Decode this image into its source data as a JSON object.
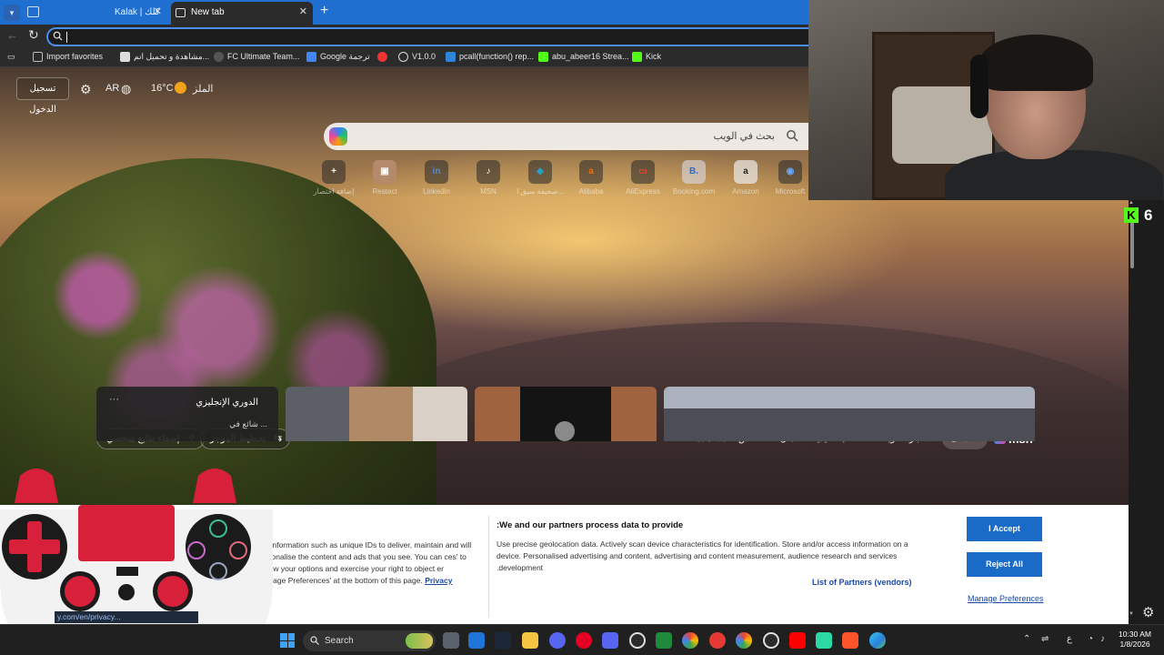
{
  "browser": {
    "tabs": [
      {
        "label": "Kalak | كلك"
      },
      {
        "label": "New tab"
      }
    ],
    "address_value": "",
    "bookmarks": [
      {
        "label": "Import favorites",
        "icon": "import-icon"
      },
      {
        "label": "مشاهدة و تحميل انم...",
        "icon": "page-icon"
      },
      {
        "label": "FC Ultimate Team...",
        "icon": "fc-icon"
      },
      {
        "label": "Google ترجمة",
        "icon": "translate-icon"
      },
      {
        "label": "",
        "icon": "youtube-icon"
      },
      {
        "label": "V1.0.0",
        "icon": "globe-icon"
      },
      {
        "label": "pcall(function() rep...",
        "icon": "bing-icon"
      },
      {
        "label": "abu_abeer16 Strea...",
        "icon": "kick-icon"
      },
      {
        "label": "Kick",
        "icon": "kick-icon"
      }
    ]
  },
  "newtab": {
    "login": "تسجيل الدخول",
    "lang": "AR",
    "temp": "16°C",
    "weather_loc": "الملز",
    "search_placeholder": "بحث في الويب",
    "quick_links": [
      {
        "label": "إضافة اختصار",
        "glyph": "+"
      },
      {
        "label": "Restect",
        "glyph": "▣"
      },
      {
        "label": "Linkedin",
        "glyph": "in"
      },
      {
        "label": "MSN",
        "glyph": "♪"
      },
      {
        "label": "صحيفة سبق ا...",
        "glyph": "◆"
      },
      {
        "label": "Alibaba",
        "glyph": "a"
      },
      {
        "label": "AliExpress",
        "glyph": "▭"
      },
      {
        "label": "Booking.com",
        "glyph": "B."
      },
      {
        "label": "Amazon",
        "glyph": "a"
      },
      {
        "label": "Microsoft",
        "glyph": "◉"
      }
    ],
    "feed": {
      "personalize": "إضفاء طابع شخصي",
      "layout": "تخطيط الموجز",
      "nav": [
        "مشاهدة",
        "الطقس",
        "المال",
        "ألعاب تقليدية",
        "رياضة",
        "الأخبار"
      ],
      "discover": "اكتشاف",
      "logo": "msn",
      "league_title": "الدوري الإنجليزي",
      "league_sub": "شائع في ..."
    }
  },
  "consent": {
    "left_text": "ess information such as unique IDs to deliver, maintain and will personalise the content and ads that you see. You can ces' to review your options and exercise your right to object er 'Manage Preferences' at the bottom of this page.",
    "privacy": "Privacy",
    "title": ":We and our partners process data to provide",
    "text": "Use precise geolocation data. Actively scan device characteristics for identification. Store and/or access information on a device. Personalised advertising and content, advertising and content measurement, audience research and services .development",
    "partners": "List of Partners (vendors)",
    "accept": "I Accept",
    "reject": "Reject All",
    "manage": "Manage Preferences",
    "url_fragment": "y.com/en/privacy..."
  },
  "stream": {
    "kick_viewers": "6"
  },
  "taskbar": {
    "search": "Search",
    "time": "10:30 AM",
    "date": "1/8/2026",
    "ime": "ع"
  },
  "colors": {
    "accent": "#1f6fd1",
    "consent_button": "#1a6ac8",
    "kick_green": "#53fc18",
    "controller_red": "#d9203a"
  }
}
